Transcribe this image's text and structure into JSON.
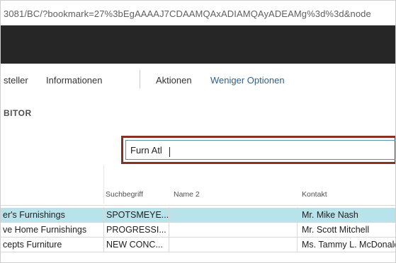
{
  "browser": {
    "url": "3081/BC/?bookmark=27%3bEgAAAAJ7CDAAMQAxADIAMQAyADEAMg%3d%3d&node"
  },
  "actions": {
    "items": [
      {
        "label": "steller",
        "style": "dark"
      },
      {
        "label": "Informationen",
        "style": "dark"
      },
      {
        "label": "Aktionen",
        "style": "dark"
      },
      {
        "label": "Weniger Optionen",
        "style": "blue"
      }
    ]
  },
  "page": {
    "title": "BITOR"
  },
  "search": {
    "value": "Furn Atl"
  },
  "table": {
    "columns": [
      "Suchbegriff",
      "Name 2",
      "Kontakt"
    ],
    "rows": [
      {
        "name": "er's Furnishings",
        "search": "SPOTSMEYE...",
        "name2": "",
        "contact": "Mr. Mike Nash",
        "selected": true
      },
      {
        "name": "ve Home Furnishings",
        "search": "PROGRESSI...",
        "name2": "",
        "contact": "Mr. Scott Mitchell",
        "selected": false
      },
      {
        "name": "cepts Furniture",
        "search": "NEW CONC...",
        "name2": "",
        "contact": "Ms. Tammy L. McDonald",
        "selected": false
      }
    ]
  },
  "colors": {
    "selected_row": "#b9e3ea",
    "search_highlight": "#8b2e24",
    "dark_bar": "#262626"
  }
}
